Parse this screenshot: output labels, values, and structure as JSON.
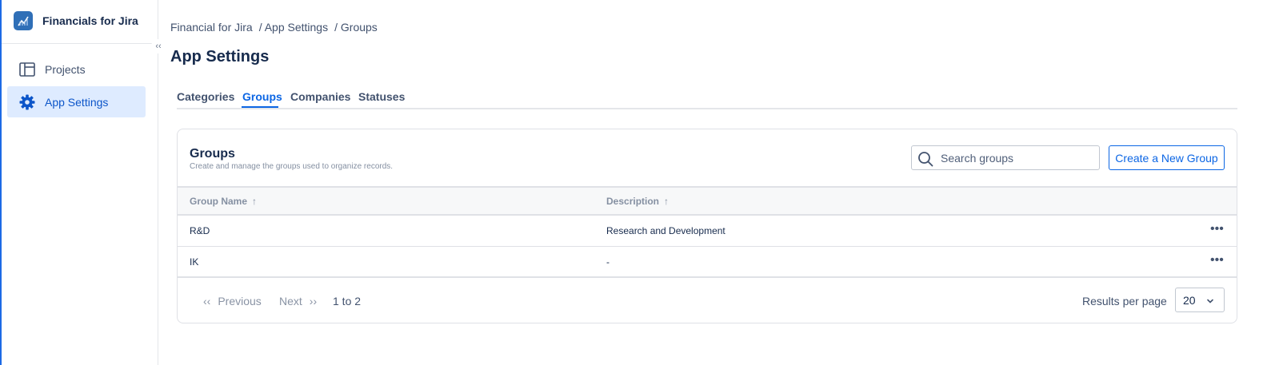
{
  "app": {
    "name": "Financials for Jira",
    "accent_color": "#0c66e4",
    "logo_icon": "chart-logo-icon"
  },
  "sidebar": {
    "collapse_icon": "double-chevron-left-icon",
    "items": [
      {
        "label": "Projects",
        "icon": "layout-icon",
        "active": false
      },
      {
        "label": "App Settings",
        "icon": "gear-icon",
        "active": true
      }
    ]
  },
  "breadcrumb": [
    "Financial for Jira",
    "/ App Settings",
    "/ Groups"
  ],
  "page_title": "App Settings",
  "tabs": [
    {
      "label": "Categories",
      "active": false
    },
    {
      "label": "Groups",
      "active": true
    },
    {
      "label": "Companies",
      "active": false
    },
    {
      "label": "Statuses",
      "active": false
    }
  ],
  "groups_card": {
    "title": "Groups",
    "subtitle": "Create and manage the groups used to organize records.",
    "search": {
      "placeholder": "Search groups",
      "value": "",
      "icon": "search-icon"
    },
    "create_button": "Create a New Group",
    "columns": [
      {
        "label": "Group Name",
        "sort": "ascending"
      },
      {
        "label": "Description",
        "sort": "ascending"
      }
    ],
    "rows": [
      {
        "name": "R&D",
        "description": "Research and Development"
      },
      {
        "name": "IK",
        "description": "-"
      }
    ],
    "pagination": {
      "previous": "Previous",
      "next": "Next",
      "range": "1 to 2",
      "results_per_page_label": "Results per page",
      "results_per_page_value": "20"
    }
  }
}
